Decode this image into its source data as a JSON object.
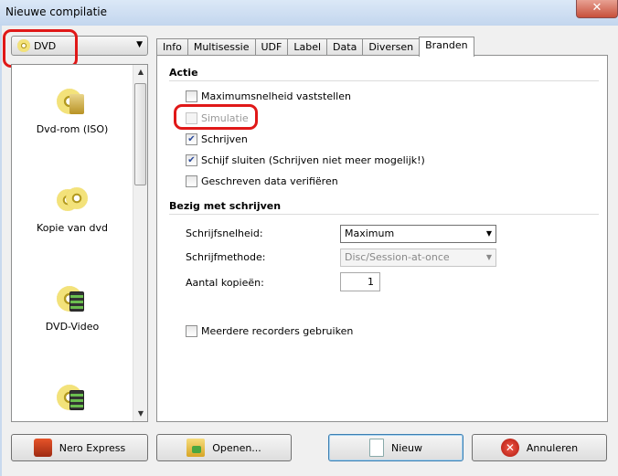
{
  "window": {
    "title": "Nieuwe compilatie",
    "close_label": "✕"
  },
  "media_select": {
    "value": "DVD"
  },
  "compile_types": [
    {
      "label": "Dvd-rom (ISO)"
    },
    {
      "label": "Kopie van dvd"
    },
    {
      "label": "DVD-Video"
    },
    {
      "label": ""
    }
  ],
  "tabs": [
    {
      "label": "Info"
    },
    {
      "label": "Multisessie"
    },
    {
      "label": "UDF"
    },
    {
      "label": "Label"
    },
    {
      "label": "Data"
    },
    {
      "label": "Diversen"
    },
    {
      "label": "Branden",
      "active": true
    }
  ],
  "actie": {
    "heading": "Actie",
    "options": [
      {
        "label": "Maximumsnelheid vaststellen",
        "checked": false,
        "disabled": false
      },
      {
        "label": "Simulatie",
        "checked": false,
        "disabled": true
      },
      {
        "label": "Schrijven",
        "checked": true,
        "disabled": false
      },
      {
        "label": "Schijf sluiten (Schrijven niet meer mogelijk!)",
        "checked": true,
        "disabled": false
      },
      {
        "label": "Geschreven data verifiëren",
        "checked": false,
        "disabled": false
      }
    ]
  },
  "bezig": {
    "heading": "Bezig met schrijven",
    "speed_label": "Schrijfsnelheid:",
    "speed_value": "Maximum",
    "method_label": "Schrijfmethode:",
    "method_value": "Disc/Session-at-once",
    "copies_label": "Aantal kopieën:",
    "copies_value": "1",
    "multi_recorders": {
      "label": "Meerdere recorders gebruiken",
      "checked": false
    }
  },
  "buttons": {
    "nero_express": "Nero Express",
    "open": "Openen...",
    "new": "Nieuw",
    "cancel": "Annuleren"
  },
  "colors": {
    "highlight": "#e01818",
    "checkmark": "#2b4a9a"
  }
}
